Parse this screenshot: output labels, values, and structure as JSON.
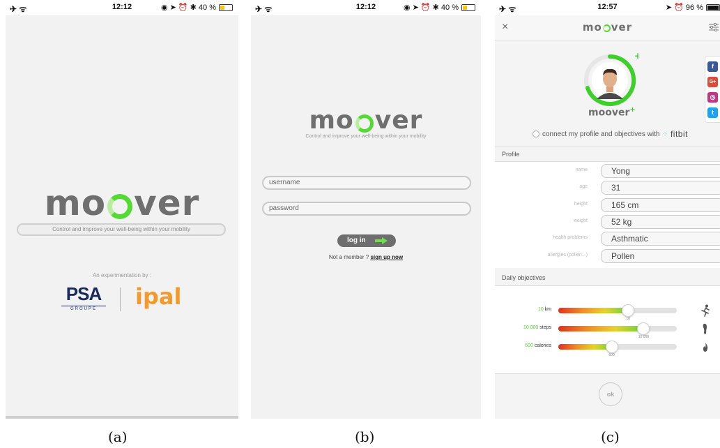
{
  "screens": {
    "a": {
      "status": {
        "left": "✈ ᯤ",
        "time": "12:12",
        "right": "◉ ➤ ⏰ ✱ 40 %"
      },
      "logo": {
        "prefix": "mo",
        "suffix": "ver"
      },
      "tagline": "Control and improve your well-being within your mobility",
      "experimentation": "An experimentation by :",
      "psa": {
        "name": "PSA",
        "sub": "GROUPE"
      },
      "ipal": {
        "name": "ipal"
      },
      "caption": "(a)"
    },
    "b": {
      "status": {
        "left": "✈ ᯤ",
        "time": "12:12",
        "right": "◉ ➤ ⏰ ✱ 40 %"
      },
      "logo": {
        "prefix": "mo",
        "suffix": "ver"
      },
      "tagline": "Control and improve your well-being within your mobility",
      "username_placeholder": "username",
      "password_placeholder": "password",
      "login_label": "log in",
      "not_member": "Not a member ? ",
      "signup": "sign up now",
      "caption": "(b)"
    },
    "c": {
      "status": {
        "left": "✈ ᯤ",
        "time": "12:57",
        "right": "➤ ⏰ 96 %"
      },
      "nav": {
        "close": "×",
        "logo_prefix": "mo",
        "logo_suffix": "ver"
      },
      "avatar_logo": "moover",
      "social": [
        "f",
        "G+",
        "◎",
        "t"
      ],
      "fitbit_text": "connect my profile and objectives with",
      "fitbit_brand": "fitbit",
      "profile_heading": "Profile",
      "profile": [
        {
          "label": "name",
          "value": "Yong"
        },
        {
          "label": "age",
          "value": "31"
        },
        {
          "label": "height",
          "value": "165 cm"
        },
        {
          "label": "weight",
          "value": "52 kg"
        },
        {
          "label": "health problems",
          "value": "Asthmatic"
        },
        {
          "label": "allergies (pollen...)",
          "value": "Pollen"
        }
      ],
      "objectives_heading": "Daily objectives",
      "objectives": [
        {
          "num": "10",
          "unit": " km",
          "tick": "10",
          "level": 0.59,
          "icon": "running-icon"
        },
        {
          "num": "10 000",
          "unit": " steps",
          "tick": "10 000",
          "level": 0.72,
          "icon": "footprint-icon"
        },
        {
          "num": "600",
          "unit": " calories",
          "tick": "600",
          "level": 0.45,
          "icon": "flame-icon"
        }
      ],
      "ok_label": "ok",
      "caption": "(c)"
    }
  },
  "colors": {
    "accent_green": "#54d935",
    "logo_gray": "#6f6f6f",
    "psa_blue": "#1b2a5c",
    "ipal_orange": "#f29a2e"
  }
}
